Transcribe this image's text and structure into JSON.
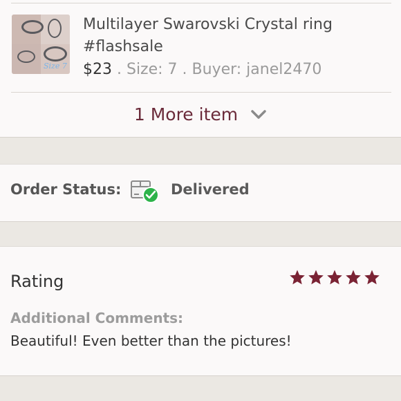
{
  "item": {
    "title": "Multilayer Swarovski Crystal ring #flashsale",
    "price": "$23",
    "size": " . Size: 7",
    "buyer": " . Buyer: janel2470",
    "thumb_label": "Size 7",
    "thumb_icon": "ring-photo-collage"
  },
  "more_items": {
    "label": "1 More item",
    "icon": "chevron-down-icon"
  },
  "order_status": {
    "label": "Order Status:",
    "value": "Delivered",
    "icon": "package-delivered-icon",
    "check_color": "#2db34a"
  },
  "rating": {
    "label": "Rating",
    "stars": 5,
    "max_stars": 5,
    "star_color": "#7a2334",
    "comments_label": "Additional Comments:",
    "comments": "Beautiful! Even better than the pictures!"
  },
  "colors": {
    "accent": "#6b2b3a",
    "background": "#ebe8e3",
    "card": "#fbf9f9"
  }
}
